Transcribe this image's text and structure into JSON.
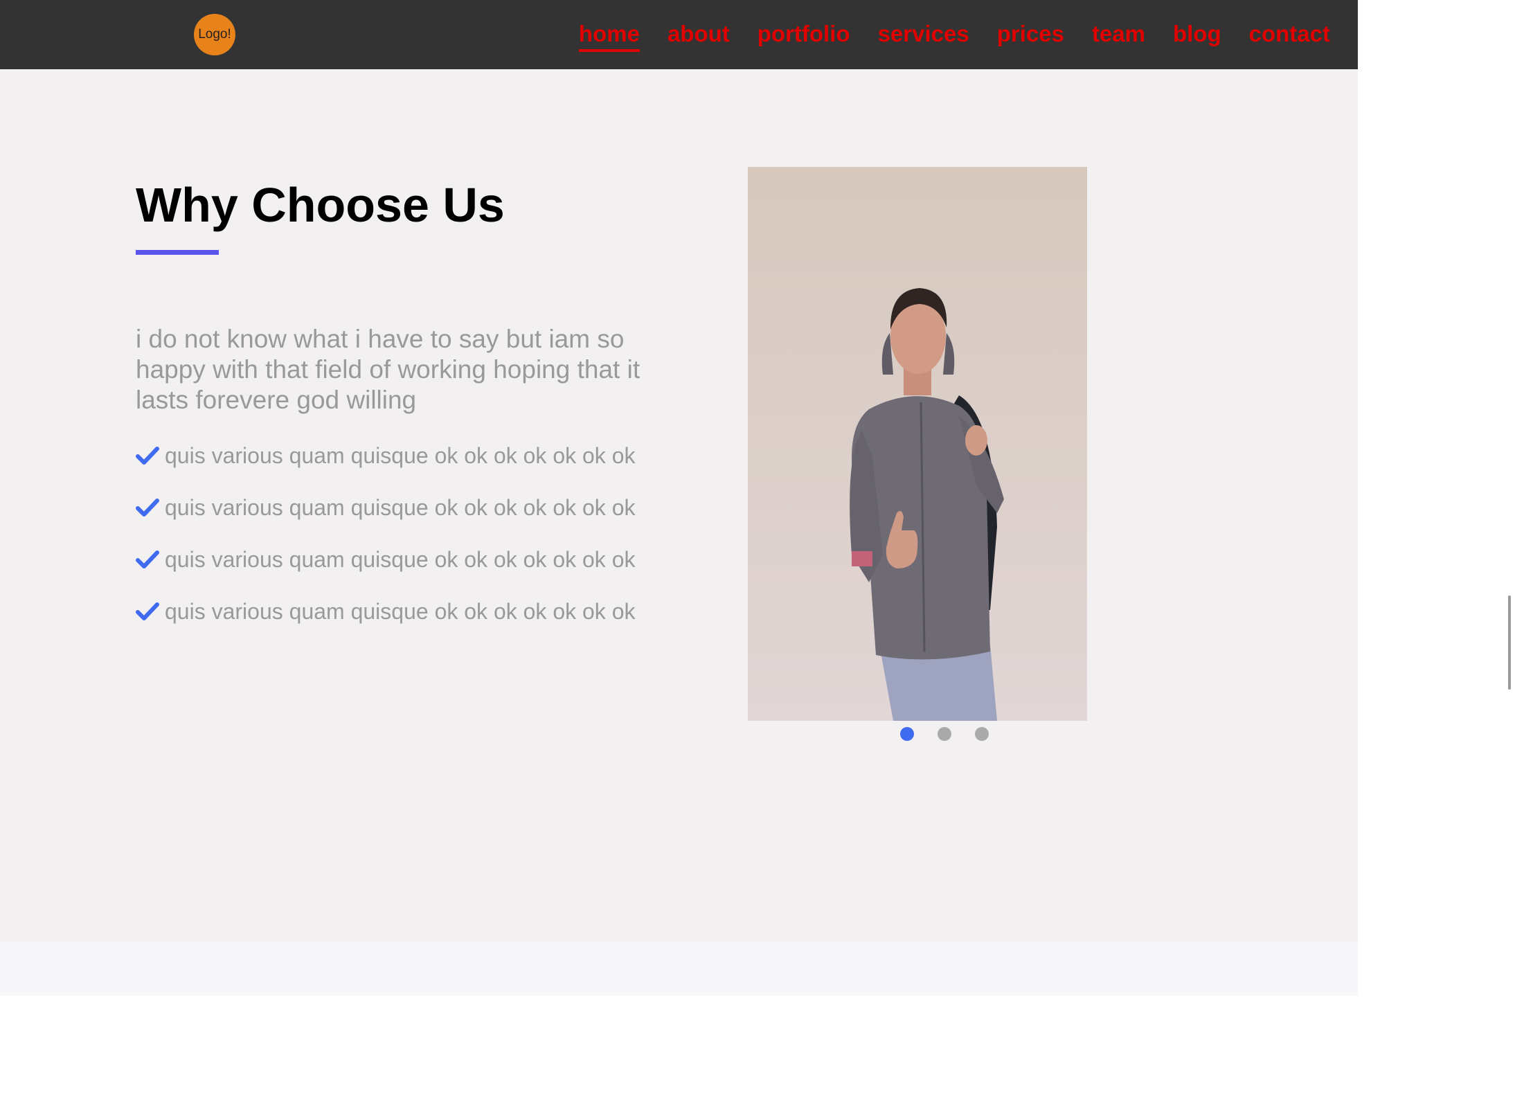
{
  "nav": {
    "logo_text": "Logo!",
    "links": [
      {
        "label": "home",
        "active": true
      },
      {
        "label": "about",
        "active": false
      },
      {
        "label": "portfolio",
        "active": false
      },
      {
        "label": "services",
        "active": false
      },
      {
        "label": "prices",
        "active": false
      },
      {
        "label": "team",
        "active": false
      },
      {
        "label": "blog",
        "active": false
      },
      {
        "label": "contact",
        "active": false
      }
    ]
  },
  "main": {
    "heading": "Why Choose Us",
    "intro": "i do not know what i have to say but iam so happy with that field of working hoping that it lasts forevere god willing",
    "features": [
      "quis various quam quisque ok ok ok ok ok ok ok",
      "quis various quam quisque ok ok ok ok ok ok ok",
      "quis various quam quisque ok ok ok ok ok ok ok",
      "quis various quam quisque ok ok ok ok ok ok ok"
    ],
    "check_icon": "check-icon"
  },
  "carousel": {
    "slide_count": 3,
    "active_index": 0
  },
  "colors": {
    "nav_bg": "#333333",
    "nav_link": "#e00000",
    "logo_bg": "#e8821a",
    "accent": "#5b54ee",
    "check": "#3f6bf0",
    "dot_active": "#3f6bf0",
    "dot_inactive": "#aaaaaa",
    "hero_bg": "#f2f0f1",
    "muted_text": "#999999"
  }
}
